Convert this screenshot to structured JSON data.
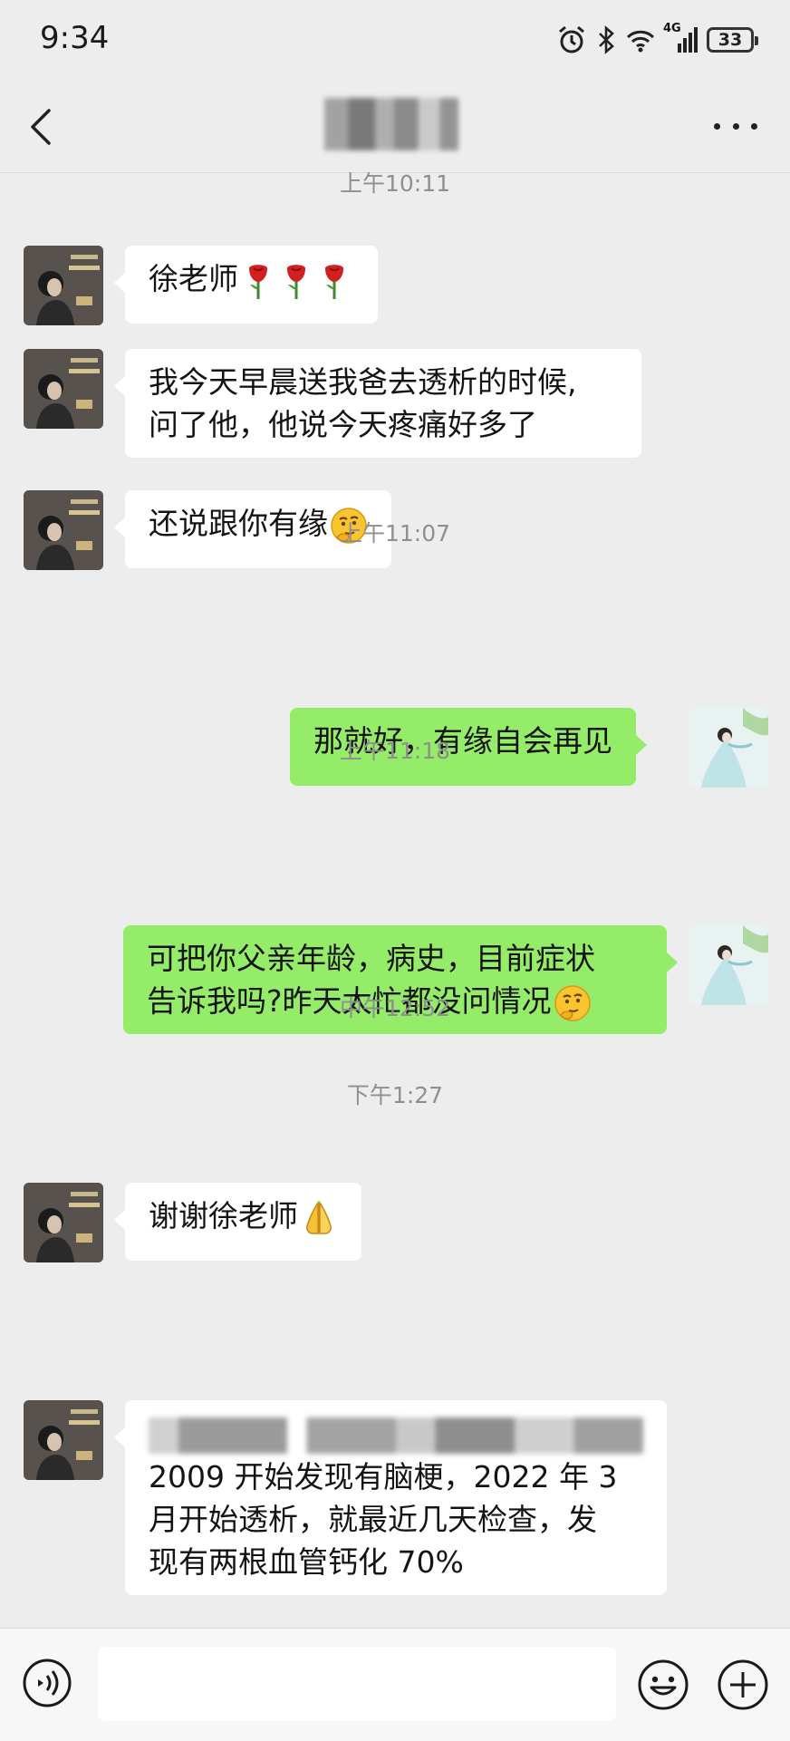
{
  "status_bar": {
    "time": "9:34",
    "network": "4G",
    "battery": "33"
  },
  "nav": {
    "back_icon": "chevron-left-icon",
    "more_icon": "more-dots-icon"
  },
  "messages": [
    {
      "type": "time",
      "text": "上午10:11"
    },
    {
      "type": "in",
      "text": "徐老师",
      "emoji": "rose"
    },
    {
      "type": "in",
      "line1": "我今天早晨送我爸去透析的时候,",
      "line2": "问了他，他说今天疼痛好多了"
    },
    {
      "type": "in",
      "text": "还说跟你有缘",
      "emoji": "thinking"
    },
    {
      "type": "time",
      "text": "上午11:07"
    },
    {
      "type": "out",
      "text": "那就好，有缘自会再见"
    },
    {
      "type": "time",
      "text": "上午11:18"
    },
    {
      "type": "out",
      "line1": "可把你父亲年龄，病史，目前症状",
      "line2": "告诉我吗?昨天太忙都没问情况",
      "emoji": "thinking"
    },
    {
      "type": "time",
      "text": "中午12:52"
    },
    {
      "type": "in",
      "text": "谢谢徐老师",
      "emoji": "folded-hands"
    },
    {
      "type": "time",
      "text": "下午1:27"
    },
    {
      "type": "in",
      "line1": "2009 开始发现有脑梗，2022 年 3",
      "line2": "月开始透析，就最近几天检查，发",
      "line3": "现有两根血管钙化 70%"
    }
  ],
  "input": {
    "placeholder": ""
  }
}
